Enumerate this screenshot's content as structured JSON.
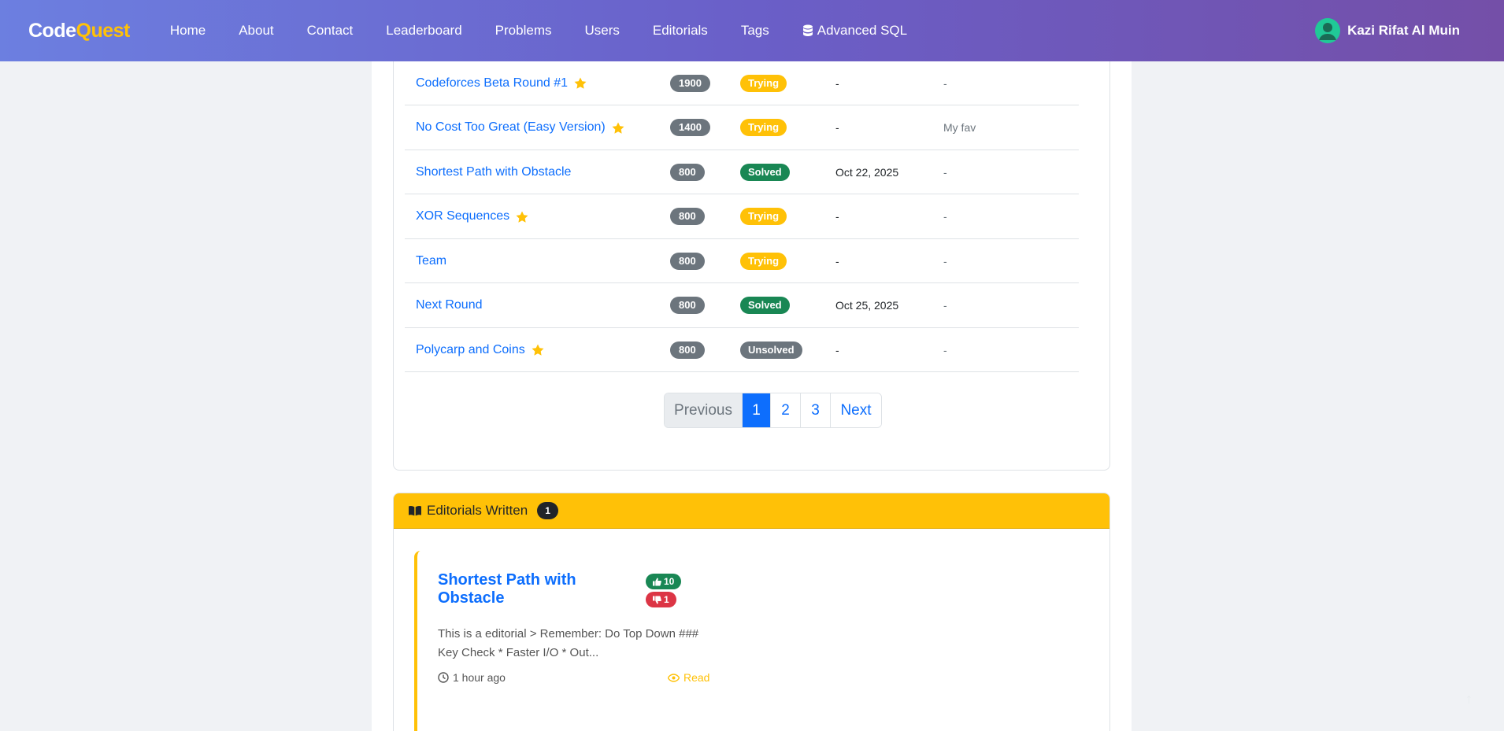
{
  "nav": {
    "brand_main": "Code",
    "brand_accent": "Quest",
    "links": [
      "Home",
      "About",
      "Contact",
      "Leaderboard",
      "Problems",
      "Users",
      "Editorials",
      "Tags",
      "Advanced SQL"
    ],
    "user_name": "Kazi Rifat Al Muin"
  },
  "problems": [
    {
      "name": "Codeforces Beta Round #1",
      "star": true,
      "rating": "1900",
      "status": "Trying",
      "date": "-",
      "note": "-"
    },
    {
      "name": "No Cost Too Great (Easy Version)",
      "star": true,
      "rating": "1400",
      "status": "Trying",
      "date": "-",
      "note": "My fav"
    },
    {
      "name": "Shortest Path with Obstacle",
      "star": false,
      "rating": "800",
      "status": "Solved",
      "date": "Oct 22, 2025",
      "note": "-"
    },
    {
      "name": "XOR Sequences",
      "star": true,
      "rating": "800",
      "status": "Trying",
      "date": "-",
      "note": "-"
    },
    {
      "name": "Team",
      "star": false,
      "rating": "800",
      "status": "Trying",
      "date": "-",
      "note": "-"
    },
    {
      "name": "Next Round",
      "star": false,
      "rating": "800",
      "status": "Solved",
      "date": "Oct 25, 2025",
      "note": "-"
    },
    {
      "name": "Polycarp and Coins",
      "star": true,
      "rating": "800",
      "status": "Unsolved",
      "date": "-",
      "note": "-"
    }
  ],
  "pagination": {
    "prev": "Previous",
    "pages": [
      "1",
      "2",
      "3"
    ],
    "active": "1",
    "next": "Next"
  },
  "editorials": {
    "header": "Editorials Written",
    "count": "1",
    "item": {
      "title": "Shortest Path with Obstacle",
      "upvotes": "10",
      "downvotes": "1",
      "excerpt": "This is a editorial > Remember: Do Top Down ### Key Check * Faster I/O * Out...",
      "time": "1 hour ago",
      "read_label": "Read"
    }
  },
  "colors": {
    "accent": "#ffc107",
    "link": "#0d6efd",
    "solved": "#198754",
    "down": "#dc3545"
  }
}
